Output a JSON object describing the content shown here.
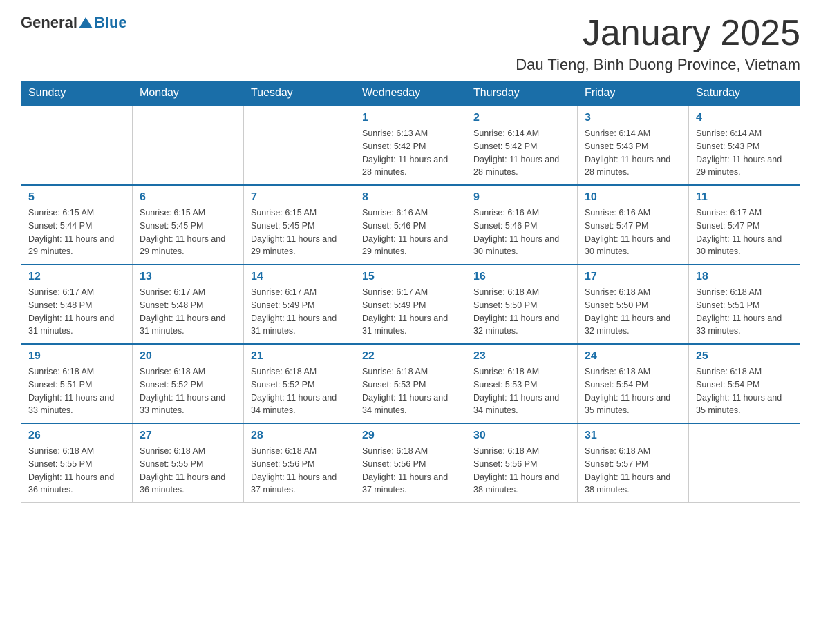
{
  "header": {
    "logo_general": "General",
    "logo_blue": "Blue",
    "main_title": "January 2025",
    "subtitle": "Dau Tieng, Binh Duong Province, Vietnam"
  },
  "days_of_week": [
    "Sunday",
    "Monday",
    "Tuesday",
    "Wednesday",
    "Thursday",
    "Friday",
    "Saturday"
  ],
  "weeks": [
    {
      "days": [
        {
          "number": "",
          "info": ""
        },
        {
          "number": "",
          "info": ""
        },
        {
          "number": "",
          "info": ""
        },
        {
          "number": "1",
          "info": "Sunrise: 6:13 AM\nSunset: 5:42 PM\nDaylight: 11 hours and 28 minutes."
        },
        {
          "number": "2",
          "info": "Sunrise: 6:14 AM\nSunset: 5:42 PM\nDaylight: 11 hours and 28 minutes."
        },
        {
          "number": "3",
          "info": "Sunrise: 6:14 AM\nSunset: 5:43 PM\nDaylight: 11 hours and 28 minutes."
        },
        {
          "number": "4",
          "info": "Sunrise: 6:14 AM\nSunset: 5:43 PM\nDaylight: 11 hours and 29 minutes."
        }
      ]
    },
    {
      "days": [
        {
          "number": "5",
          "info": "Sunrise: 6:15 AM\nSunset: 5:44 PM\nDaylight: 11 hours and 29 minutes."
        },
        {
          "number": "6",
          "info": "Sunrise: 6:15 AM\nSunset: 5:45 PM\nDaylight: 11 hours and 29 minutes."
        },
        {
          "number": "7",
          "info": "Sunrise: 6:15 AM\nSunset: 5:45 PM\nDaylight: 11 hours and 29 minutes."
        },
        {
          "number": "8",
          "info": "Sunrise: 6:16 AM\nSunset: 5:46 PM\nDaylight: 11 hours and 29 minutes."
        },
        {
          "number": "9",
          "info": "Sunrise: 6:16 AM\nSunset: 5:46 PM\nDaylight: 11 hours and 30 minutes."
        },
        {
          "number": "10",
          "info": "Sunrise: 6:16 AM\nSunset: 5:47 PM\nDaylight: 11 hours and 30 minutes."
        },
        {
          "number": "11",
          "info": "Sunrise: 6:17 AM\nSunset: 5:47 PM\nDaylight: 11 hours and 30 minutes."
        }
      ]
    },
    {
      "days": [
        {
          "number": "12",
          "info": "Sunrise: 6:17 AM\nSunset: 5:48 PM\nDaylight: 11 hours and 31 minutes."
        },
        {
          "number": "13",
          "info": "Sunrise: 6:17 AM\nSunset: 5:48 PM\nDaylight: 11 hours and 31 minutes."
        },
        {
          "number": "14",
          "info": "Sunrise: 6:17 AM\nSunset: 5:49 PM\nDaylight: 11 hours and 31 minutes."
        },
        {
          "number": "15",
          "info": "Sunrise: 6:17 AM\nSunset: 5:49 PM\nDaylight: 11 hours and 31 minutes."
        },
        {
          "number": "16",
          "info": "Sunrise: 6:18 AM\nSunset: 5:50 PM\nDaylight: 11 hours and 32 minutes."
        },
        {
          "number": "17",
          "info": "Sunrise: 6:18 AM\nSunset: 5:50 PM\nDaylight: 11 hours and 32 minutes."
        },
        {
          "number": "18",
          "info": "Sunrise: 6:18 AM\nSunset: 5:51 PM\nDaylight: 11 hours and 33 minutes."
        }
      ]
    },
    {
      "days": [
        {
          "number": "19",
          "info": "Sunrise: 6:18 AM\nSunset: 5:51 PM\nDaylight: 11 hours and 33 minutes."
        },
        {
          "number": "20",
          "info": "Sunrise: 6:18 AM\nSunset: 5:52 PM\nDaylight: 11 hours and 33 minutes."
        },
        {
          "number": "21",
          "info": "Sunrise: 6:18 AM\nSunset: 5:52 PM\nDaylight: 11 hours and 34 minutes."
        },
        {
          "number": "22",
          "info": "Sunrise: 6:18 AM\nSunset: 5:53 PM\nDaylight: 11 hours and 34 minutes."
        },
        {
          "number": "23",
          "info": "Sunrise: 6:18 AM\nSunset: 5:53 PM\nDaylight: 11 hours and 34 minutes."
        },
        {
          "number": "24",
          "info": "Sunrise: 6:18 AM\nSunset: 5:54 PM\nDaylight: 11 hours and 35 minutes."
        },
        {
          "number": "25",
          "info": "Sunrise: 6:18 AM\nSunset: 5:54 PM\nDaylight: 11 hours and 35 minutes."
        }
      ]
    },
    {
      "days": [
        {
          "number": "26",
          "info": "Sunrise: 6:18 AM\nSunset: 5:55 PM\nDaylight: 11 hours and 36 minutes."
        },
        {
          "number": "27",
          "info": "Sunrise: 6:18 AM\nSunset: 5:55 PM\nDaylight: 11 hours and 36 minutes."
        },
        {
          "number": "28",
          "info": "Sunrise: 6:18 AM\nSunset: 5:56 PM\nDaylight: 11 hours and 37 minutes."
        },
        {
          "number": "29",
          "info": "Sunrise: 6:18 AM\nSunset: 5:56 PM\nDaylight: 11 hours and 37 minutes."
        },
        {
          "number": "30",
          "info": "Sunrise: 6:18 AM\nSunset: 5:56 PM\nDaylight: 11 hours and 38 minutes."
        },
        {
          "number": "31",
          "info": "Sunrise: 6:18 AM\nSunset: 5:57 PM\nDaylight: 11 hours and 38 minutes."
        },
        {
          "number": "",
          "info": ""
        }
      ]
    }
  ]
}
